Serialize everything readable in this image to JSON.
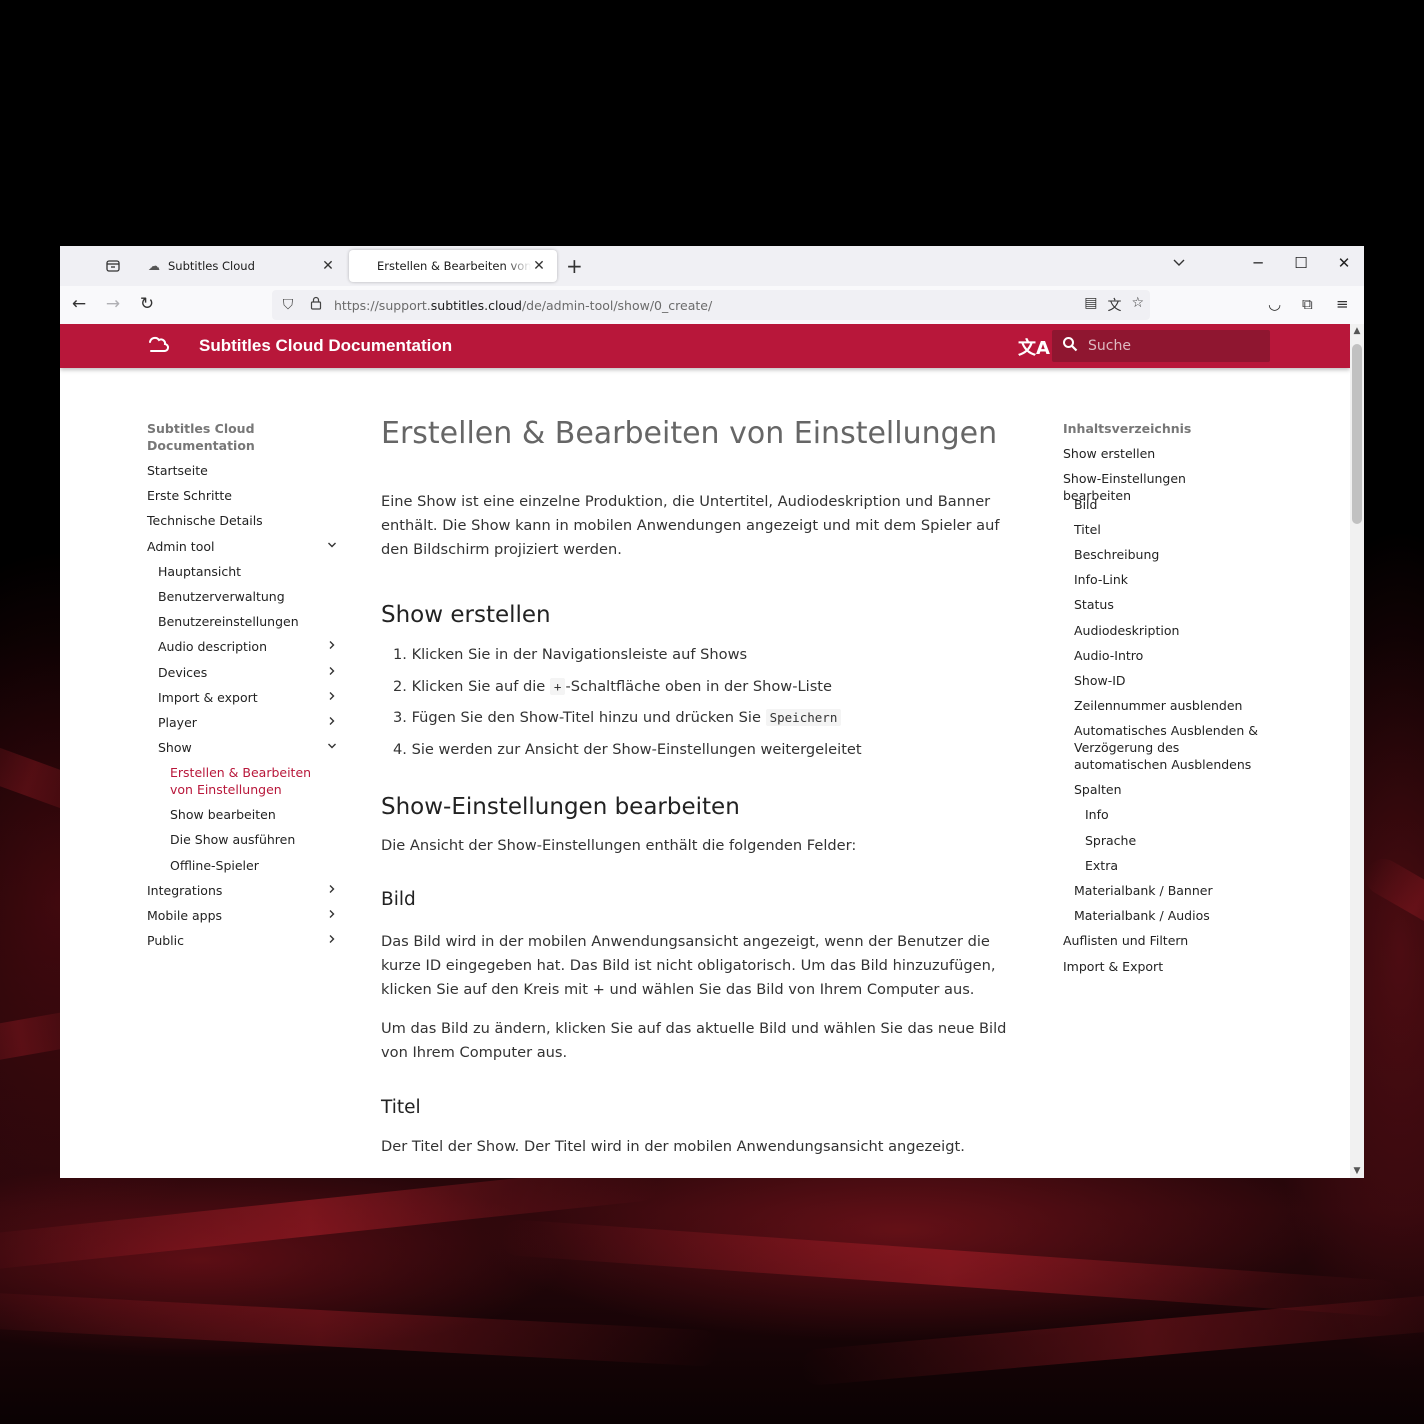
{
  "browser": {
    "tabs": [
      {
        "title": "Subtitles Cloud",
        "active": false
      },
      {
        "title": "Erstellen & Bearbeiten von Einstellungen",
        "active": true
      }
    ],
    "url_prefix": "https://support.",
    "url_domain": "subtitles.cloud",
    "url_path": "/de/admin-tool/show/0_create/"
  },
  "site": {
    "title": "Subtitles Cloud Documentation",
    "search_placeholder": "Suche",
    "accent_color": "#b8173a"
  },
  "leftnav": {
    "title": "Subtitles Cloud Documentation",
    "items": [
      {
        "label": "Startseite",
        "level": 1,
        "chevron": ""
      },
      {
        "label": "Erste Schritte",
        "level": 1,
        "chevron": ""
      },
      {
        "label": "Technische Details",
        "level": 1,
        "chevron": ""
      },
      {
        "label": "Admin tool",
        "level": 1,
        "chevron": "down"
      },
      {
        "label": "Hauptansicht",
        "level": 2,
        "chevron": ""
      },
      {
        "label": "Benutzerverwaltung",
        "level": 2,
        "chevron": ""
      },
      {
        "label": "Benutzereinstellungen",
        "level": 2,
        "chevron": ""
      },
      {
        "label": "Audio description",
        "level": 2,
        "chevron": "right"
      },
      {
        "label": "Devices",
        "level": 2,
        "chevron": "right"
      },
      {
        "label": "Import & export",
        "level": 2,
        "chevron": "right"
      },
      {
        "label": "Player",
        "level": 2,
        "chevron": "right"
      },
      {
        "label": "Show",
        "level": 2,
        "chevron": "down"
      },
      {
        "label": "Erstellen & Bearbeiten von Einstellungen",
        "level": 3,
        "chevron": "",
        "active": true
      },
      {
        "label": "Show bearbeiten",
        "level": 3,
        "chevron": ""
      },
      {
        "label": "Die Show ausführen",
        "level": 3,
        "chevron": ""
      },
      {
        "label": "Offline-Spieler",
        "level": 3,
        "chevron": ""
      },
      {
        "label": "Integrations",
        "level": 1,
        "chevron": "right"
      },
      {
        "label": "Mobile apps",
        "level": 1,
        "chevron": "right"
      },
      {
        "label": "Public",
        "level": 1,
        "chevron": "right"
      }
    ]
  },
  "content": {
    "h1": "Erstellen & Bearbeiten von Einstellungen",
    "intro": "Eine Show ist eine einzelne Produktion, die Untertitel, Audiodeskription und Banner enthält. Die Show kann in mobilen Anwendungen angezeigt und mit dem Spieler auf den Bildschirm projiziert werden.",
    "h2_create": "Show erstellen",
    "steps": {
      "s1": "1. Klicken Sie in der Navigationsleiste auf Shows",
      "s2_before": "2. Klicken Sie auf die ",
      "s2_code": "+",
      "s2_after": "-Schaltfläche oben in der Show-Liste",
      "s3_before": "3. Fügen Sie den Show-Titel hinzu und drücken Sie ",
      "s3_code": "Speichern",
      "s4": "4. Sie werden zur Ansicht der Show-Einstellungen weitergeleitet"
    },
    "h2_edit": "Show-Einstellungen bearbeiten",
    "edit_intro": "Die Ansicht der Show-Einstellungen enthält die folgenden Felder:",
    "h3_bild": "Bild",
    "bild_p1": "Das Bild wird in der mobilen Anwendungsansicht angezeigt, wenn der Benutzer die kurze ID eingegeben hat. Das Bild ist nicht obligatorisch. Um das Bild hinzuzufügen, klicken Sie auf den Kreis mit + und wählen Sie das Bild von Ihrem Computer aus.",
    "bild_p2": "Um das Bild zu ändern, klicken Sie auf das aktuelle Bild und wählen Sie das neue Bild von Ihrem Computer aus.",
    "h3_titel": "Titel",
    "titel_p": "Der Titel der Show. Der Titel wird in der mobilen Anwendungsansicht angezeigt."
  },
  "toc": {
    "title": "Inhaltsverzeichnis",
    "items": [
      {
        "label": "Show erstellen",
        "level": 1
      },
      {
        "label": "Show-Einstellungen bearbeiten",
        "level": 1
      },
      {
        "label": "Bild",
        "level": 2
      },
      {
        "label": "Titel",
        "level": 2
      },
      {
        "label": "Beschreibung",
        "level": 2
      },
      {
        "label": "Info-Link",
        "level": 2
      },
      {
        "label": "Status",
        "level": 2
      },
      {
        "label": "Audiodeskription",
        "level": 2
      },
      {
        "label": "Audio-Intro",
        "level": 2
      },
      {
        "label": "Show-ID",
        "level": 2
      },
      {
        "label": "Zeilennummer ausblenden",
        "level": 2
      },
      {
        "label": "Automatisches Ausblenden & Verzögerung des automatischen Ausblendens",
        "level": 2,
        "lines": 3
      },
      {
        "label": "Spalten",
        "level": 2
      },
      {
        "label": "Info",
        "level": 3
      },
      {
        "label": "Sprache",
        "level": 3
      },
      {
        "label": "Extra",
        "level": 3
      },
      {
        "label": "Materialbank / Banner",
        "level": 2
      },
      {
        "label": "Materialbank / Audios",
        "level": 2
      },
      {
        "label": "Auflisten und Filtern",
        "level": 1
      },
      {
        "label": "Import & Export",
        "level": 1
      }
    ]
  }
}
